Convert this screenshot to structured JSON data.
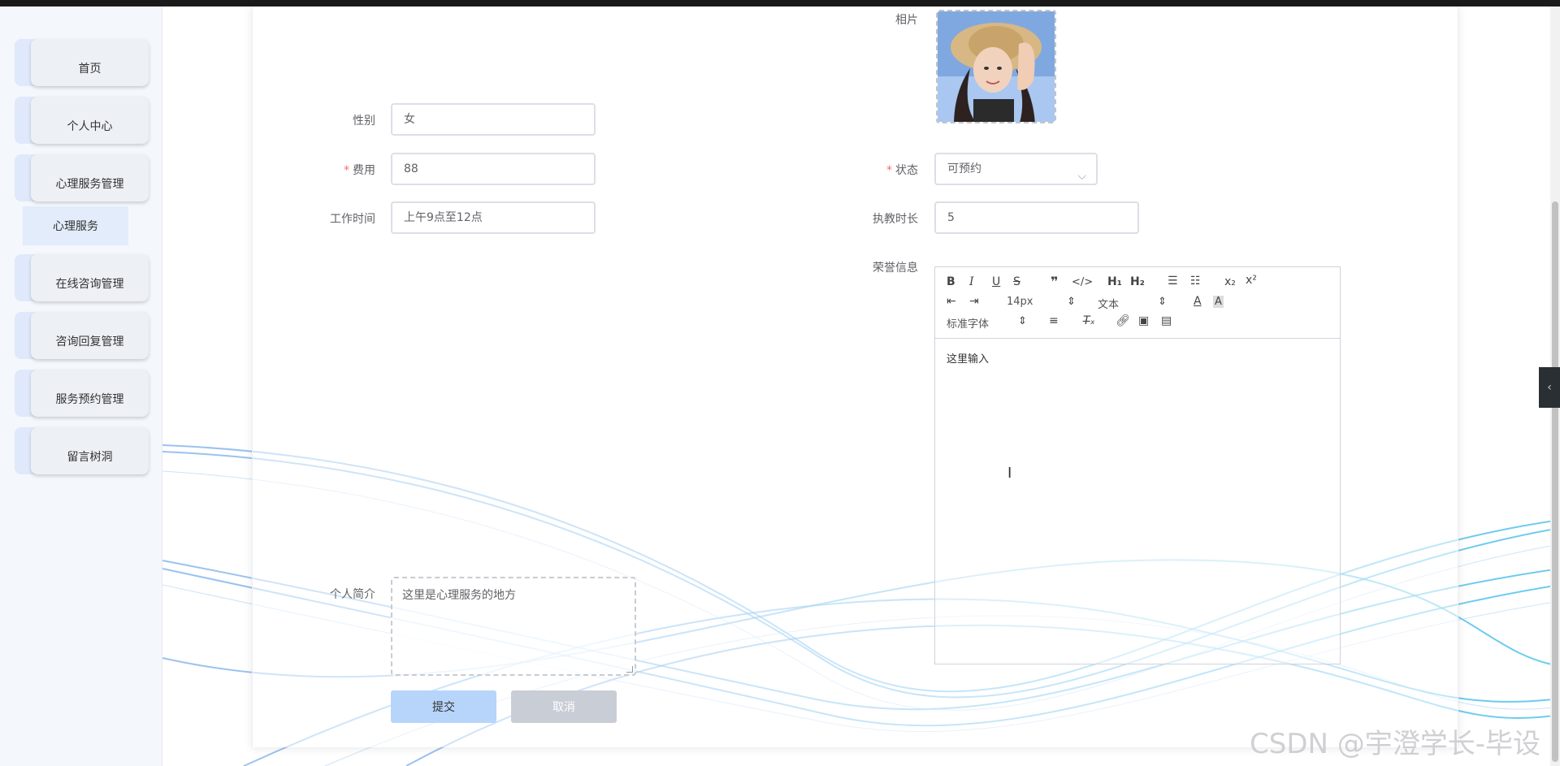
{
  "sidebar": {
    "items": [
      {
        "label": "首页"
      },
      {
        "label": "个人中心"
      },
      {
        "label": "心理服务管理"
      },
      {
        "label": "在线咨询管理"
      },
      {
        "label": "咨询回复管理"
      },
      {
        "label": "服务预约管理"
      },
      {
        "label": "留言树洞"
      }
    ],
    "submenu": {
      "label": "心理服务"
    }
  },
  "form": {
    "photo": {
      "label": "相片"
    },
    "gender": {
      "label": "性别",
      "value": "女"
    },
    "fee": {
      "label": "费用",
      "value": "88",
      "required": "*"
    },
    "status": {
      "label": "状态",
      "value": "可预约",
      "required": "*"
    },
    "work_time": {
      "label": "工作时间",
      "value": "上午9点至12点"
    },
    "teaching_years": {
      "label": "执教时长",
      "value": "5"
    },
    "honor": {
      "label": "荣誉信息"
    },
    "intro": {
      "label": "个人简介",
      "value": "这里是心理服务的地方"
    }
  },
  "editor": {
    "font_size": "14px",
    "header": "文本",
    "font_family": "标准字体",
    "placeholder": "这里输入"
  },
  "buttons": {
    "submit": "提交",
    "cancel": "取消"
  },
  "watermark": "CSDN @宇澄学长-毕设",
  "colors": {
    "accent": "#b7d5fb",
    "required": "#f56c6c",
    "sidebar_bg": "#f4f7fc"
  }
}
